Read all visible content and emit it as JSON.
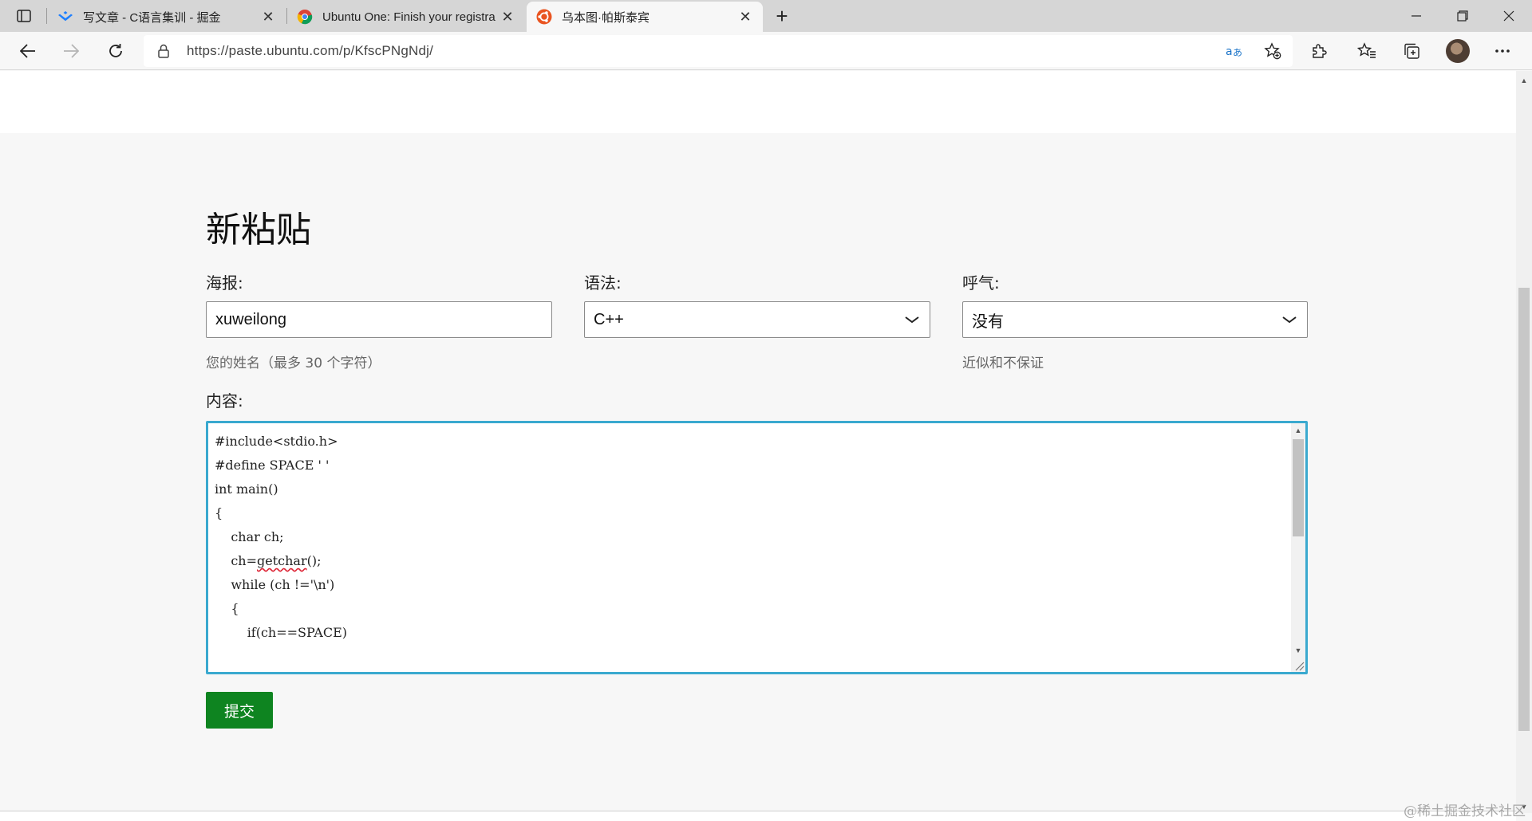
{
  "browser": {
    "tabs": [
      {
        "title": "写文章 - C语言集训 - 掘金",
        "favicon": "juejin-logo-icon"
      },
      {
        "title": "Ubuntu One: Finish your registra",
        "favicon": "chrome-logo-icon"
      },
      {
        "title": "乌本图·帕斯泰宾",
        "favicon": "ubuntu-logo-icon",
        "active": true
      }
    ],
    "url": "https://paste.ubuntu.com/p/KfscPNgNdj/",
    "accent": "#3aa9cf"
  },
  "page": {
    "heading": "新粘贴",
    "poster": {
      "label": "海报:",
      "value": "xuweilong",
      "hint": "您的姓名（最多 30 个字符）"
    },
    "syntax": {
      "label": "语法:",
      "value": "C++"
    },
    "expiration": {
      "label": "呼气:",
      "value": "没有",
      "hint": "近似和不保证"
    },
    "content": {
      "label": "内容:",
      "lines": [
        "#include<stdio.h>",
        "#define SPACE ' '",
        "int main()",
        "{",
        "    char ch;",
        "",
        "    ch=getchar();",
        "    while (ch !='\\n')",
        "    {",
        "        if(ch==SPACE)"
      ]
    },
    "submit_label": "提交",
    "submit_color": "#0e8420"
  },
  "watermark": "@稀土掘金技术社区"
}
